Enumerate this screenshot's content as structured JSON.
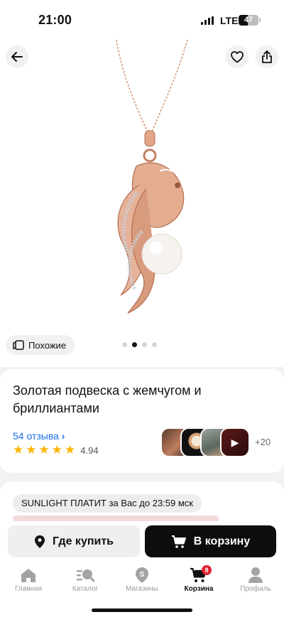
{
  "status_bar": {
    "time": "21:00",
    "network": "LTE",
    "battery": "47"
  },
  "product": {
    "similar_label": "Похожие",
    "title": "Золотая подвеска с жемчугом и бриллиантами",
    "reviews_label": "54 отзыва",
    "rating": "4.94",
    "stars": 5,
    "more_media": "+20",
    "gallery_pages": 4,
    "gallery_active_index": 1
  },
  "promo": {
    "text": "SUNLIGHT ПЛАТИТ за Вас до 23:59 мск"
  },
  "actions": {
    "where_to_buy": "Где купить",
    "add_to_cart": "В корзину"
  },
  "tabbar": {
    "items": [
      {
        "label": "Главная",
        "icon": "home-icon"
      },
      {
        "label": "Каталог",
        "icon": "catalog-search-icon"
      },
      {
        "label": "Магазины",
        "icon": "store-pin-icon"
      },
      {
        "label": "Корзина",
        "icon": "cart-icon",
        "badge": "8"
      },
      {
        "label": "Профиль",
        "icon": "profile-icon"
      }
    ]
  },
  "colors": {
    "accent_link": "#1e6fe6",
    "star": "#ffb400",
    "badge": "#e0222e",
    "primary_button": "#0d0d0d"
  }
}
